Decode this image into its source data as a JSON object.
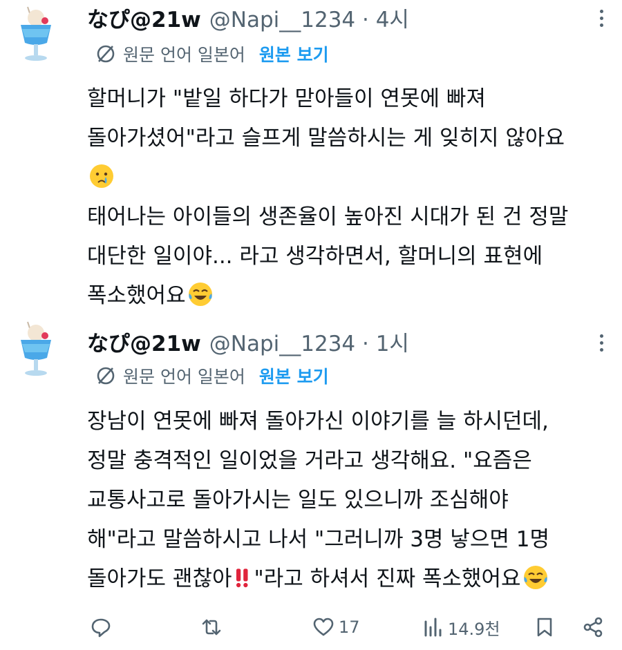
{
  "tweets": [
    {
      "name": "なぴ@21w",
      "handle": "@Napi__1234 · 4시",
      "translation_label": "원문 언어 일본어",
      "view_original": "원본 보기",
      "lines": [
        "할머니가 \"밭일 하다가 맏아들이 연못에 빠져",
        "돌아가셨어\"라고 슬프게 말씀하시는 게 잊히지 않아요",
        "",
        "태어나는 아이들의 생존율이 높아진 시대가 된 건 정말",
        "대단한 일이야... 라고 생각하면서, 할머니의 표현에",
        "폭소했어요"
      ],
      "icons": {
        "avatar": "parfait-glass-avatar",
        "sad_emoji": "crying-face-emoji",
        "laugh_emoji": "tears-of-joy-emoji"
      }
    },
    {
      "name": "なぴ@21w",
      "handle": "@Napi__1234 · 1시",
      "translation_label": "원문 언어 일본어",
      "view_original": "원본 보기",
      "lines": [
        "장남이 연못에 빠져 돌아가신 이야기를 늘 하시던데,",
        "정말 충격적인 일이었을 거라고 생각해요. \"요즘은",
        "교통사고로 돌아가시는 일도 있으니까 조심해야",
        "해\"라고 말씀하시고 나서 \"그러니까 3명 낳으면 1명",
        "돌아가도 괜찮아",
        "\"라고 하셔서 진짜 폭소했어요"
      ],
      "icons": {
        "avatar": "parfait-glass-avatar",
        "exclamation_emoji": "double-exclamation-emoji",
        "laugh_emoji": "tears-of-joy-emoji"
      }
    }
  ],
  "actions": {
    "reply": "",
    "retweet": "",
    "like_count": "17",
    "views_count": "14.9천"
  },
  "colors": {
    "text": "#0f1419",
    "muted": "#536471",
    "link": "#1d9bf0"
  }
}
